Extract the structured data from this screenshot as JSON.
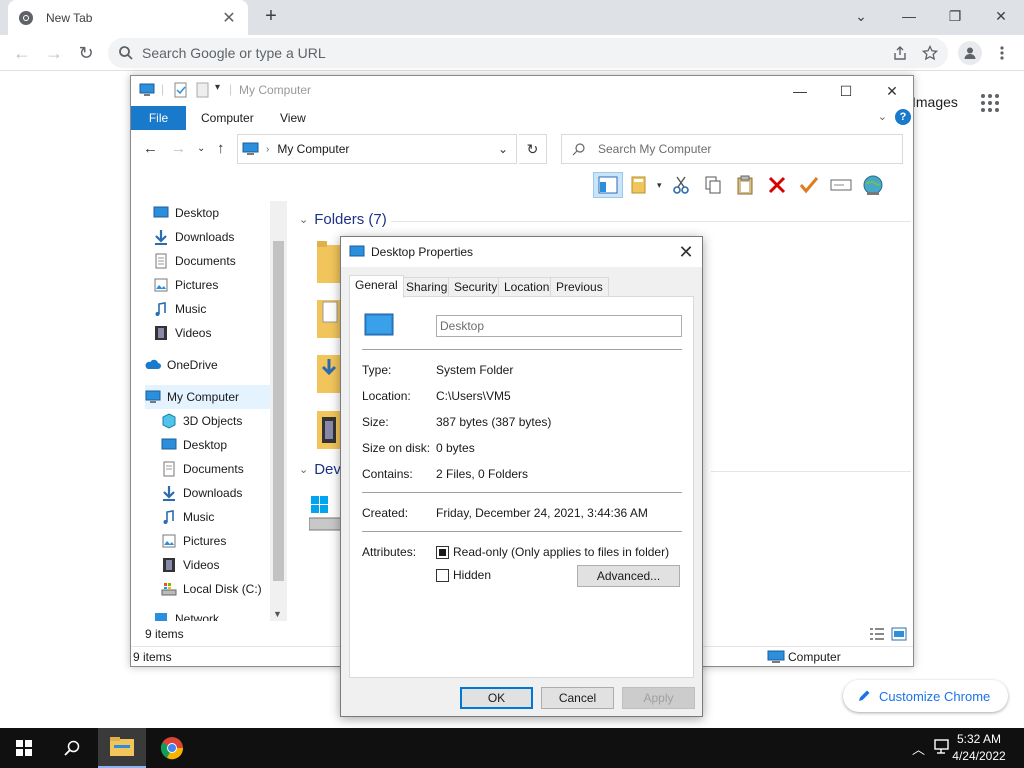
{
  "chrome": {
    "tab_title": "New Tab",
    "omnibox_placeholder": "Search Google or type a URL",
    "images_link": "Images",
    "customize_label": "Customize Chrome"
  },
  "explorer": {
    "title": "My Computer",
    "ribbon_tabs": [
      "File",
      "Computer",
      "View"
    ],
    "address": "My Computer",
    "search_placeholder": "Search My Computer",
    "nav_items": [
      {
        "label": "Desktop",
        "icon": "desktop-icon",
        "pinned": true
      },
      {
        "label": "Downloads",
        "icon": "downloads-icon",
        "pinned": true
      },
      {
        "label": "Documents",
        "icon": "documents-icon",
        "pinned": true
      },
      {
        "label": "Pictures",
        "icon": "pictures-icon",
        "pinned": true
      },
      {
        "label": "Music",
        "icon": "music-icon",
        "pinned": false
      },
      {
        "label": "Videos",
        "icon": "videos-icon",
        "pinned": false
      },
      {
        "label": "OneDrive",
        "icon": "onedrive-icon",
        "pinned": false
      },
      {
        "label": "My Computer",
        "icon": "computer-icon",
        "pinned": false
      },
      {
        "label": "3D Objects",
        "icon": "3d-objects-icon",
        "pinned": false
      },
      {
        "label": "Desktop",
        "icon": "desktop-icon",
        "pinned": false
      },
      {
        "label": "Documents",
        "icon": "documents-icon",
        "pinned": false
      },
      {
        "label": "Downloads",
        "icon": "downloads-icon",
        "pinned": false
      },
      {
        "label": "Music",
        "icon": "music-icon",
        "pinned": false
      },
      {
        "label": "Pictures",
        "icon": "pictures-icon",
        "pinned": false
      },
      {
        "label": "Videos",
        "icon": "videos-icon",
        "pinned": false
      },
      {
        "label": "Local Disk (C:)",
        "icon": "local-disk-icon",
        "pinned": false
      },
      {
        "label": "Network",
        "icon": "network-icon",
        "pinned": false
      }
    ],
    "folders_group": "Folders (7)",
    "devices_group": "Devi",
    "status_count": "9 items",
    "status_count_bottom": "9 items",
    "status_location": "Computer"
  },
  "dialog": {
    "title": "Desktop Properties",
    "tabs": [
      "General",
      "Sharing",
      "Security",
      "Location",
      "Previous Versions"
    ],
    "name_value": "Desktop",
    "properties": {
      "type_label": "Type:",
      "type_value": "System Folder",
      "location_label": "Location:",
      "location_value": "C:\\Users\\VM5",
      "size_label": "Size:",
      "size_value": "387 bytes (387 bytes)",
      "size_on_disk_label": "Size on disk:",
      "size_on_disk_value": "0 bytes",
      "contains_label": "Contains:",
      "contains_value": "2 Files, 0 Folders",
      "created_label": "Created:",
      "created_value": "Friday, December 24, 2021, 3:44:36 AM",
      "attributes_label": "Attributes:"
    },
    "readonly_label": "Read-only (Only applies to files in folder)",
    "readonly_checked": true,
    "hidden_label": "Hidden",
    "hidden_checked": false,
    "advanced_label": "Advanced...",
    "ok_label": "OK",
    "cancel_label": "Cancel",
    "apply_label": "Apply"
  },
  "taskbar": {
    "time": "5:32 AM",
    "date": "4/24/2022"
  },
  "colors": {
    "accent": "#1979ca",
    "folder": "#f2c55c",
    "delete_red": "#d90000",
    "check_orange": "#e07b1f",
    "chrome_blue": "#1a73e8"
  }
}
